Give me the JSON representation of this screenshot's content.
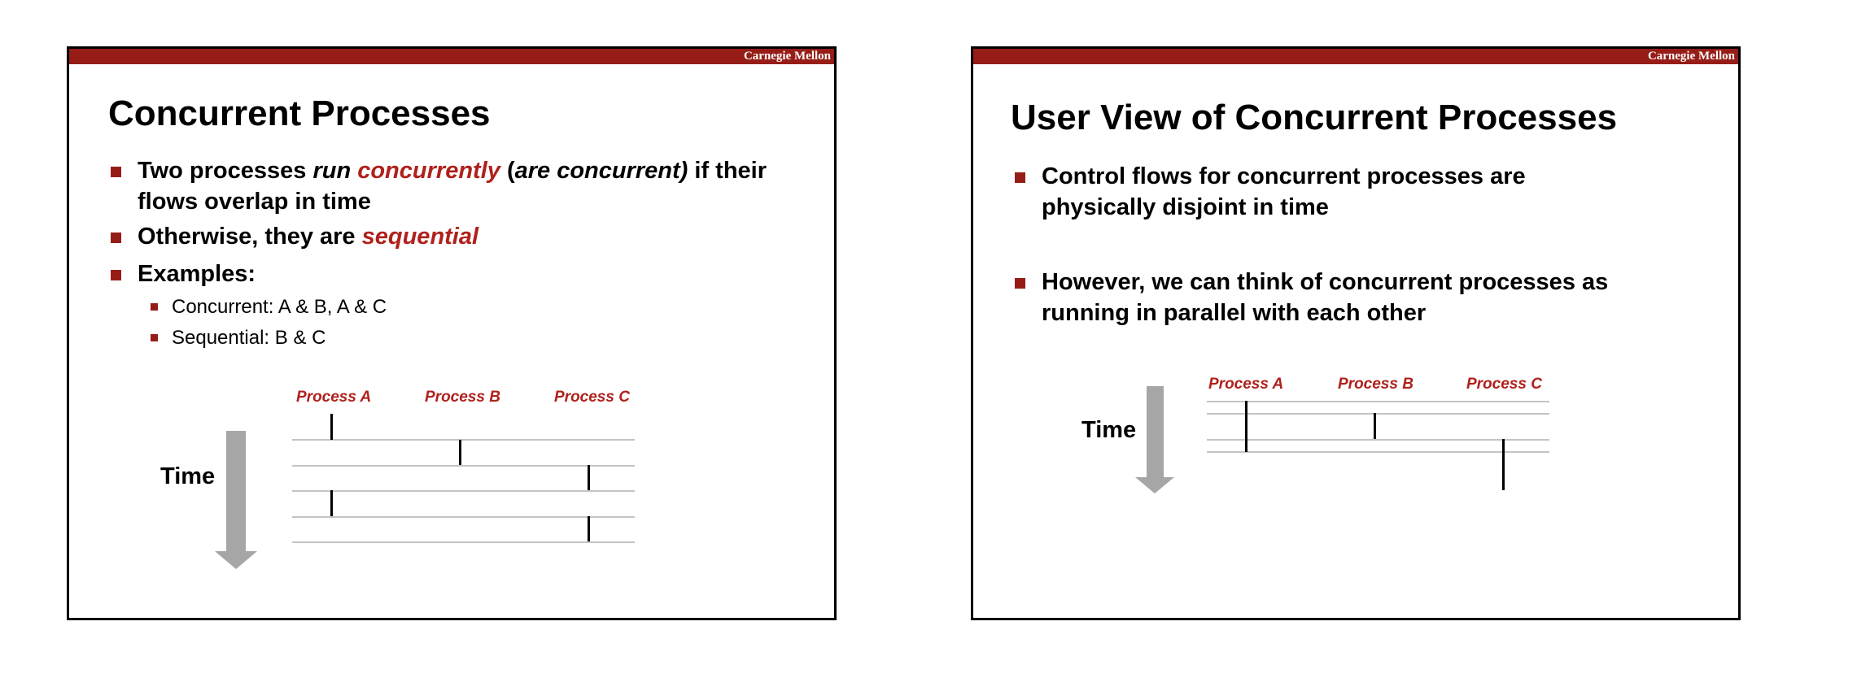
{
  "brand": "Carnegie Mellon",
  "slide1": {
    "title": "Concurrent Processes",
    "bullet1": {
      "t1": "Two processes ",
      "t2": "run ",
      "t3": "concurrently",
      "t4": " (",
      "t5": "are concurrent)",
      "t6": " if their flows overlap in time"
    },
    "bullet2": {
      "t1": "Otherwise, they are ",
      "t2": "sequential"
    },
    "bullet3": "Examples:",
    "sub1": "Concurrent: A & B, A & C",
    "sub2": "Sequential: B & C",
    "time_label": "Time",
    "processes": [
      "Process A",
      "Process B",
      "Process C"
    ]
  },
  "slide2": {
    "title": "User View of Concurrent Processes",
    "bullet1": "Control flows for concurrent processes are physically disjoint in time",
    "bullet2": "However, we can think of concurrent processes as running in parallel with each other",
    "time_label": "Time",
    "processes": [
      "Process A",
      "Process B",
      "Process C"
    ]
  },
  "colors": {
    "header_bar": "#961d17",
    "accent_red": "#b0211c",
    "arrow_gray": "#a6a6a6",
    "timeline_gray": "#c4c4c4"
  }
}
